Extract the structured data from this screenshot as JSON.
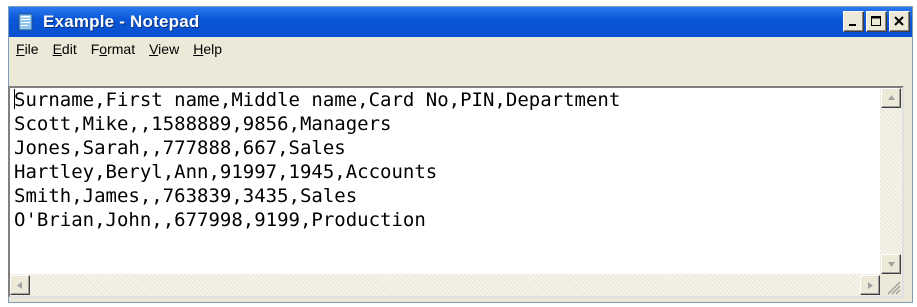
{
  "window": {
    "title": "Example - Notepad",
    "controls": {
      "minimize": "_",
      "maximize": "□",
      "close": "×"
    }
  },
  "menu": [
    {
      "accel": "F",
      "rest": "ile"
    },
    {
      "accel": "E",
      "rest": "dit"
    },
    {
      "pre": "F",
      "accel": "o",
      "rest": "rmat"
    },
    {
      "accel": "V",
      "rest": "iew"
    },
    {
      "accel": "H",
      "rest": "elp"
    }
  ],
  "document": {
    "lines": [
      "Surname,First name,Middle name,Card No,PIN,Department",
      "Scott,Mike,,1588889,9856,Managers",
      "Jones,Sarah,,777888,667,Sales",
      "Hartley,Beryl,Ann,91997,1945,Accounts",
      "Smith,James,,763839,3435,Sales",
      "O'Brian,John,,677998,9199,Production"
    ]
  },
  "colors": {
    "titlebar": "#0a58d8",
    "chrome": "#ece9d8"
  },
  "icons": {
    "app": "notepad-icon",
    "scroll_up": "arrow-up-icon",
    "scroll_down": "arrow-down-icon",
    "scroll_left": "arrow-left-icon",
    "scroll_right": "arrow-right-icon",
    "resize": "size-grip-icon"
  }
}
